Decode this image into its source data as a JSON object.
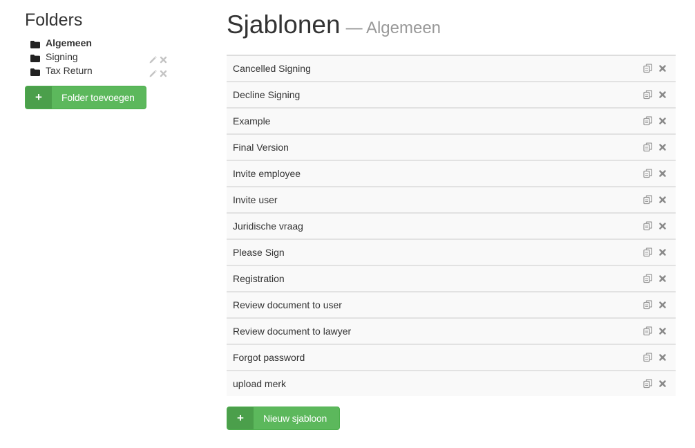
{
  "sidebar": {
    "title": "Folders",
    "folders": [
      {
        "label": "Algemeen",
        "active": true,
        "icon": "folder-icon"
      },
      {
        "label": "Signing",
        "active": false,
        "icon": "folder-icon",
        "actions": [
          "pencil-icon",
          "close-icon"
        ]
      },
      {
        "label": "Tax Return",
        "active": false,
        "icon": "folder-icon",
        "actions": [
          "pencil-icon",
          "close-icon"
        ]
      }
    ],
    "add_button": {
      "icon": "plus-icon",
      "plus": "+",
      "label": "Folder toevoegen"
    }
  },
  "main": {
    "title": "Sjablonen",
    "subtitle": "— Algemeen",
    "templates": [
      {
        "name": "Cancelled Signing"
      },
      {
        "name": "Decline Signing"
      },
      {
        "name": "Example"
      },
      {
        "name": "Final Version"
      },
      {
        "name": "Invite employee"
      },
      {
        "name": "Invite user"
      },
      {
        "name": "Juridische vraag"
      },
      {
        "name": "Please Sign"
      },
      {
        "name": "Registration"
      },
      {
        "name": "Review document to user"
      },
      {
        "name": "Review document to lawyer"
      },
      {
        "name": "Forgot password"
      },
      {
        "name": "upload merk"
      }
    ],
    "row_actions": [
      "copy-icon",
      "close-icon"
    ],
    "add_button": {
      "icon": "plus-icon",
      "plus": "+",
      "label": "Nieuw sjabloon"
    }
  },
  "colors": {
    "accent_green": "#5cb85c",
    "accent_green_dark": "#4b9f4b",
    "row_background": "#f9f9f9",
    "icon_gray": "#9a9a9a",
    "subtitle_gray": "#999999"
  }
}
